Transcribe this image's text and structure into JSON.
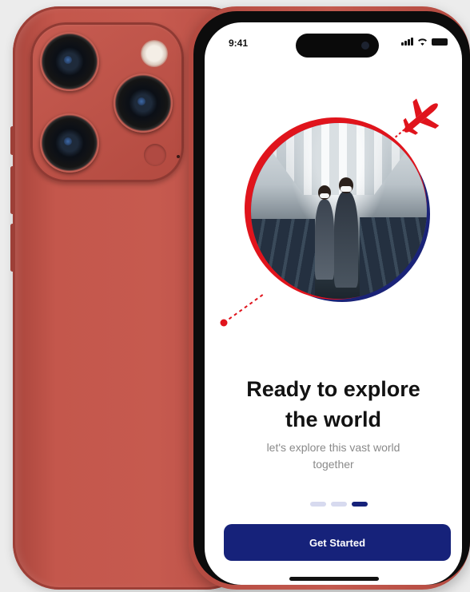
{
  "status_bar": {
    "time": "9:41"
  },
  "onboarding": {
    "title_line1": "Ready to explore",
    "title_line2": "the world",
    "subtitle_line1": "let's explore this vast world",
    "subtitle_line2": "together",
    "page_indicator": {
      "pages": 3,
      "active_index": 2
    },
    "cta_label": "Get Started"
  },
  "colors": {
    "primary": "#16227a",
    "accent_red": "#e0141c",
    "phone_body": "#c35a4f",
    "inactive_dot": "#d7daef"
  },
  "icons": [
    "airplane-icon",
    "signal-icon",
    "wifi-icon",
    "battery-icon"
  ]
}
